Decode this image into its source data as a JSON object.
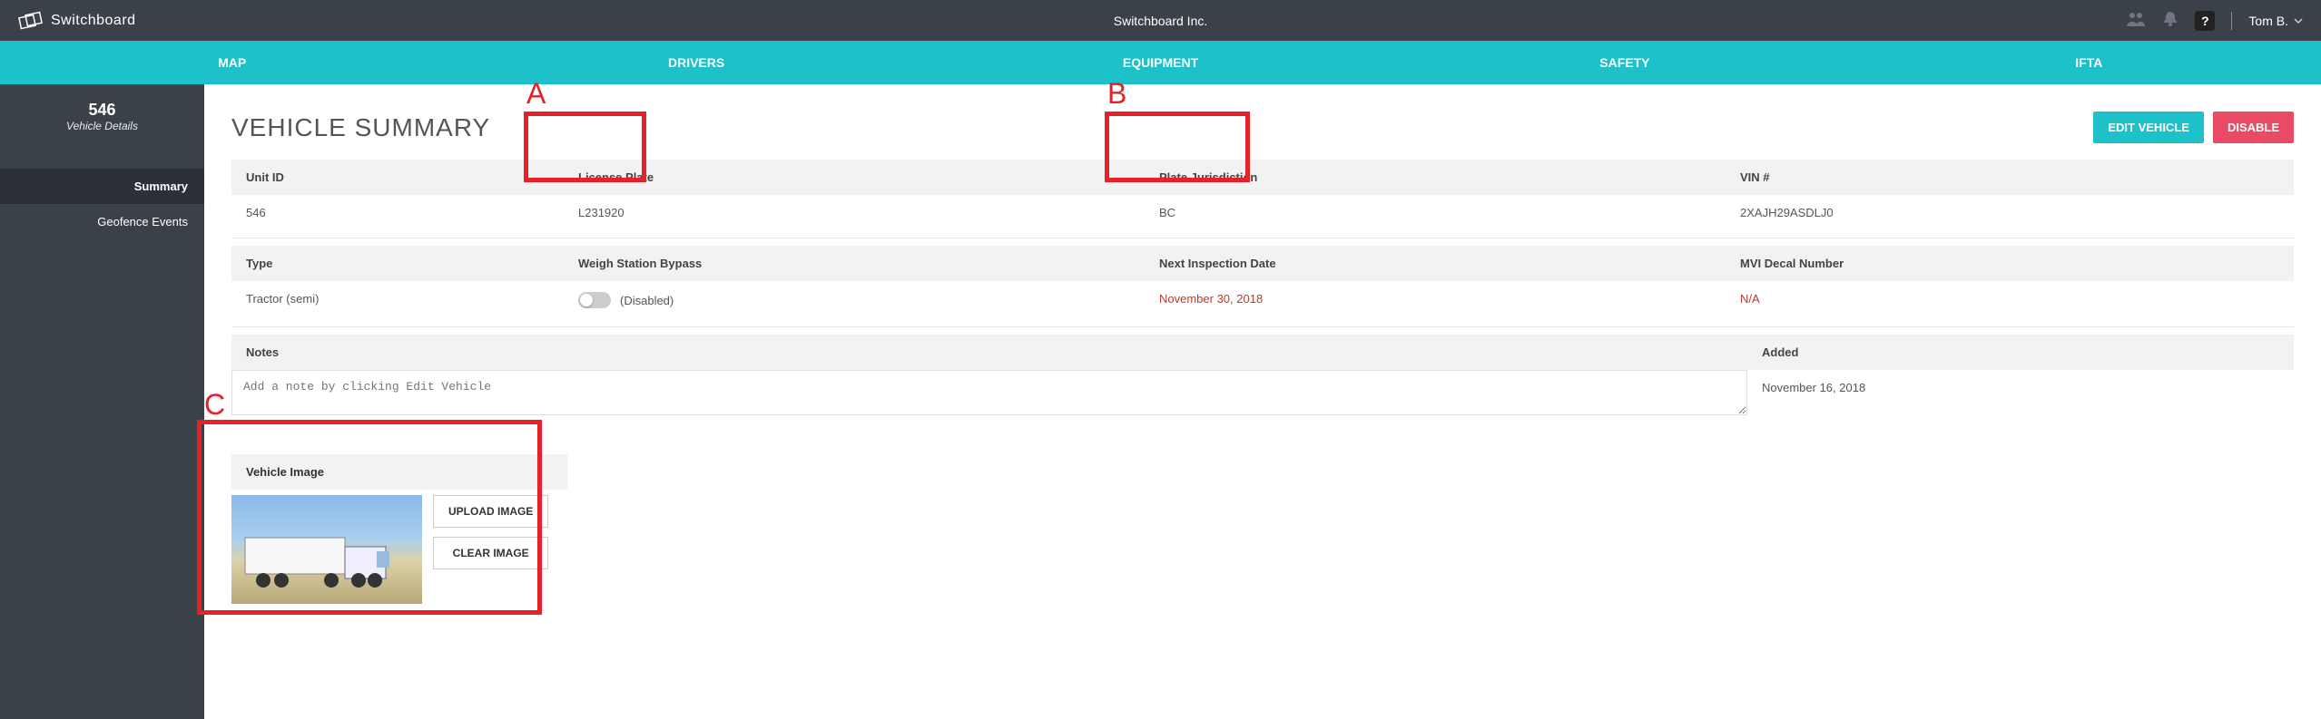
{
  "topbar": {
    "brand": "Switchboard",
    "company": "Switchboard Inc.",
    "help": "?",
    "user": "Tom B."
  },
  "nav": {
    "map": "MAP",
    "drivers": "DRIVERS",
    "equipment": "EQUIPMENT",
    "safety": "SAFETY",
    "ifta": "IFTA"
  },
  "sidebar": {
    "id": "546",
    "sub": "Vehicle Details",
    "items": [
      {
        "label": "Summary",
        "active": true
      },
      {
        "label": "Geofence Events",
        "active": false
      }
    ]
  },
  "page": {
    "title": "VEHICLE SUMMARY",
    "edit_btn": "EDIT VEHICLE",
    "disable_btn": "DISABLE"
  },
  "annotations": {
    "a": "A",
    "b": "B",
    "c": "C"
  },
  "row1": {
    "unit_id_label": "Unit ID",
    "unit_id_value": "546",
    "plate_label": "License Plate",
    "plate_value": "L231920",
    "juris_label": "Plate Jurisdiction",
    "juris_value": "BC",
    "vin_label": "VIN #",
    "vin_value": "2XAJH29ASDLJ0"
  },
  "row2": {
    "type_label": "Type",
    "type_value": "Tractor (semi)",
    "weigh_label": "Weigh Station Bypass",
    "weigh_value": "(Disabled)",
    "insp_label": "Next Inspection Date",
    "insp_value": "November 30, 2018",
    "mvi_label": "MVI Decal Number",
    "mvi_value": "N/A"
  },
  "row3": {
    "notes_label": "Notes",
    "notes_placeholder": "Add a note by clicking Edit Vehicle",
    "added_label": "Added",
    "added_value": "November 16, 2018"
  },
  "vimg": {
    "label": "Vehicle Image",
    "upload": "UPLOAD IMAGE",
    "clear": "CLEAR IMAGE"
  }
}
